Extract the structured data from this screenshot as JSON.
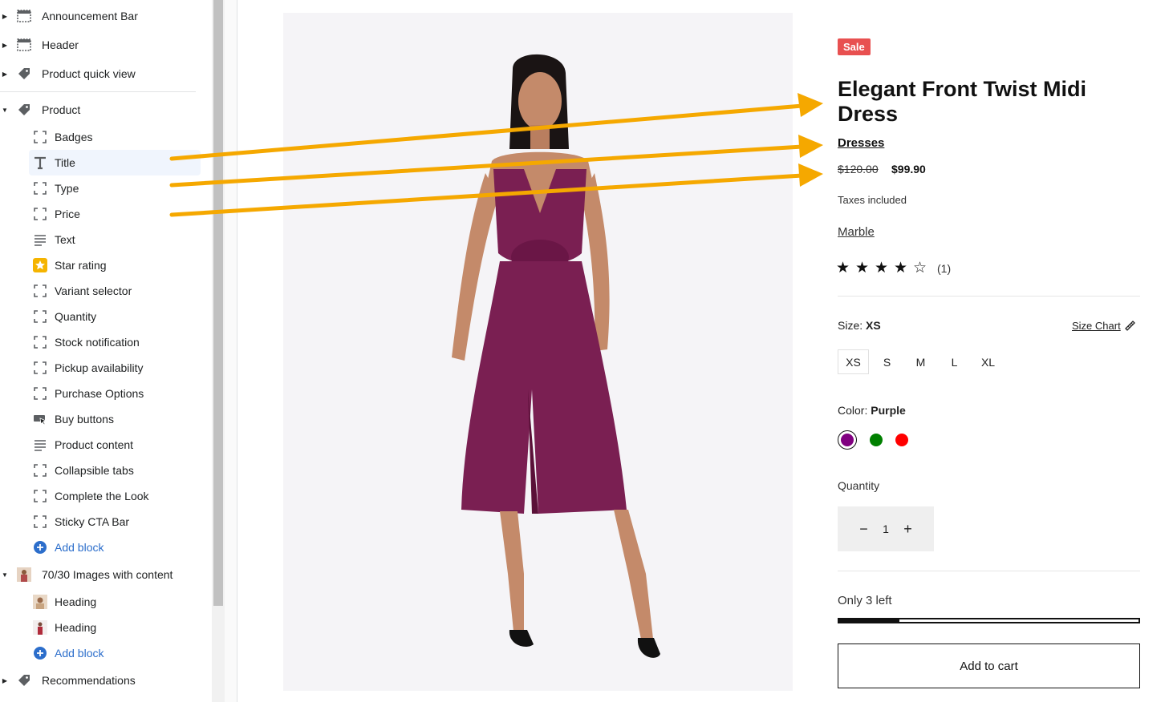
{
  "sidebar": {
    "sections": [
      {
        "label": "Announcement Bar",
        "icon": "layout-header-icon"
      },
      {
        "label": "Header",
        "icon": "layout-header-icon"
      },
      {
        "label": "Product quick view",
        "icon": "tag-icon"
      },
      {
        "label": "Product",
        "icon": "tag-icon",
        "expanded": true
      }
    ],
    "product_blocks": [
      {
        "label": "Badges",
        "icon": "block-icon"
      },
      {
        "label": "Title",
        "icon": "text-t-icon",
        "selected": true
      },
      {
        "label": "Type",
        "icon": "block-icon"
      },
      {
        "label": "Price",
        "icon": "block-icon"
      },
      {
        "label": "Text",
        "icon": "text-lines-icon"
      },
      {
        "label": "Star rating",
        "icon": "star-app-icon"
      },
      {
        "label": "Variant selector",
        "icon": "block-icon"
      },
      {
        "label": "Quantity",
        "icon": "block-icon"
      },
      {
        "label": "Stock notification",
        "icon": "block-icon"
      },
      {
        "label": "Pickup availability",
        "icon": "block-icon"
      },
      {
        "label": "Purchase Options",
        "icon": "block-icon"
      },
      {
        "label": "Buy buttons",
        "icon": "buy-buttons-icon"
      },
      {
        "label": "Product content",
        "icon": "text-lines-icon"
      },
      {
        "label": "Collapsible tabs",
        "icon": "block-icon"
      },
      {
        "label": "Complete the Look",
        "icon": "block-icon"
      },
      {
        "label": "Sticky CTA Bar",
        "icon": "block-icon"
      }
    ],
    "add_block_label": "Add block",
    "images_section": {
      "label": "70/30 Images with content",
      "icon": "image-thumb-icon"
    },
    "images_blocks": [
      {
        "label": "Heading",
        "icon": "image-thumb-icon"
      },
      {
        "label": "Heading",
        "icon": "image-thumb-icon"
      }
    ],
    "add_block_label_2": "Add block",
    "recommendations": {
      "label": "Recommendations",
      "icon": "tag-icon"
    }
  },
  "product": {
    "badge": "Sale",
    "title": "Elegant Front Twist Midi Dress",
    "type": "Dresses",
    "compare_price": "$120.00",
    "price": "$99.90",
    "taxes": "Taxes included",
    "vendor": "Marble",
    "rating": 4,
    "rating_max": 5,
    "rating_count": "(1)",
    "size_label": "Size:",
    "size_value": "XS",
    "size_chart": "Size Chart",
    "sizes": [
      "XS",
      "S",
      "M",
      "L",
      "XL"
    ],
    "color_label": "Color:",
    "color_value": "Purple",
    "colors": [
      "#800080",
      "#008000",
      "#ff0000"
    ],
    "quantity_label": "Quantity",
    "quantity_value": "1",
    "quantity_minus": "−",
    "quantity_plus": "+",
    "stock_text": "Only 3 left",
    "stock_fraction": 0.2,
    "add_to_cart": "Add to cart"
  },
  "colors": {
    "sale_badge": "#e85050",
    "annotation_arrow": "#f5a800",
    "accent_link": "#2c6ecb",
    "dress": "#7a1f52"
  }
}
